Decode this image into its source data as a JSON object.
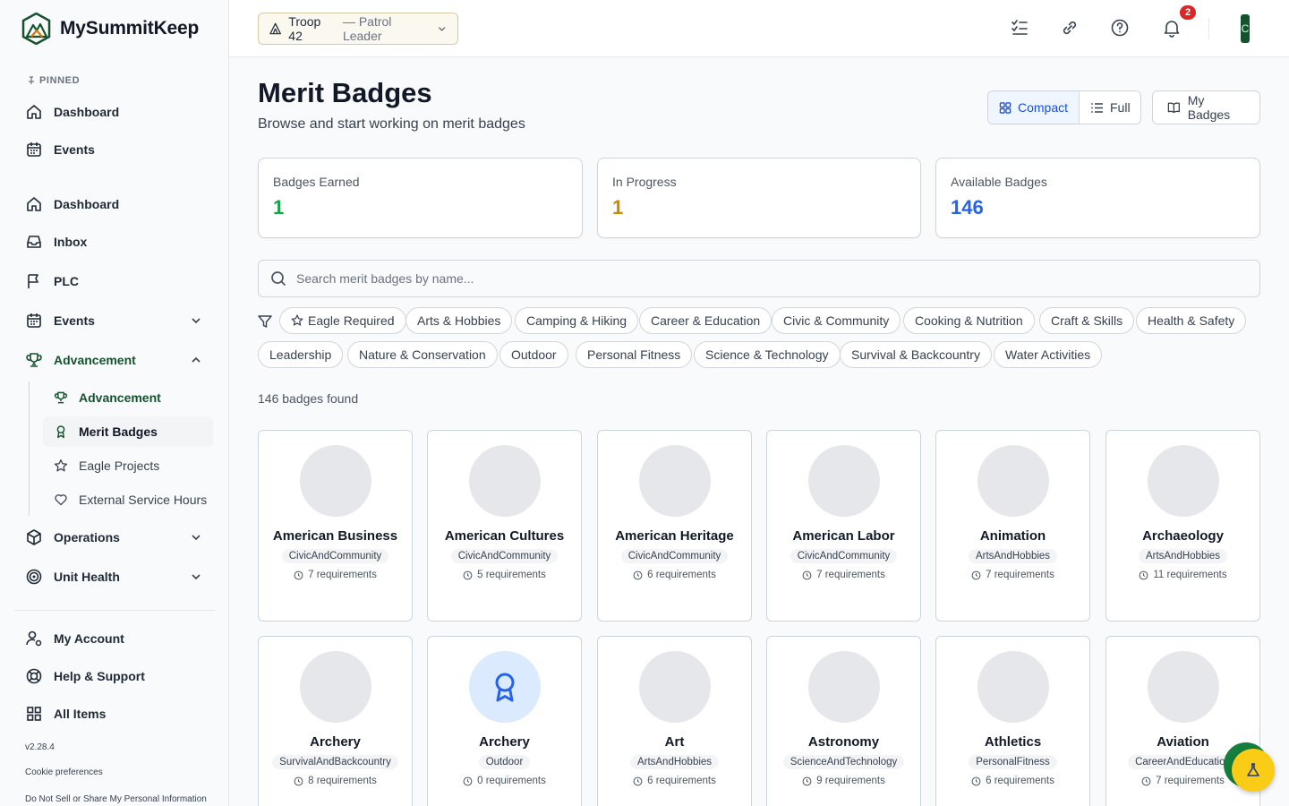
{
  "app": {
    "name": "MySummitKeep",
    "version": "v2.28.4"
  },
  "sidebar": {
    "pinned_label": "PINNED",
    "pinned": [
      {
        "label": "Dashboard",
        "icon": "home-icon"
      },
      {
        "label": "Events",
        "icon": "calendar-icon"
      }
    ],
    "items": [
      {
        "label": "Dashboard",
        "icon": "home-icon"
      },
      {
        "label": "Inbox",
        "icon": "inbox-icon"
      },
      {
        "label": "PLC",
        "icon": "flag-icon"
      },
      {
        "label": "Events",
        "icon": "calendar-icon",
        "expandable": true
      },
      {
        "label": "Advancement",
        "icon": "trophy-icon",
        "expanded": true
      },
      {
        "label": "Operations",
        "icon": "box-icon",
        "expandable": true
      },
      {
        "label": "Unit Health",
        "icon": "target-icon",
        "expandable": true
      }
    ],
    "advancement_sub": [
      {
        "label": "Advancement",
        "icon": "trophy-icon"
      },
      {
        "label": "Merit Badges",
        "icon": "badge-icon",
        "selected": true
      },
      {
        "label": "Eagle Projects",
        "icon": "star-icon"
      },
      {
        "label": "External Service Hours",
        "icon": "heart-icon"
      }
    ],
    "bottom": [
      {
        "label": "My Account",
        "icon": "user-gear-icon"
      },
      {
        "label": "Help & Support",
        "icon": "lifebuoy-icon"
      },
      {
        "label": "All Items",
        "icon": "grid-icon"
      }
    ],
    "cookie": "Cookie preferences",
    "dnsmpi": "Do Not Sell or Share My Personal Information"
  },
  "topbar": {
    "troop": "Troop 42",
    "role": "— Patrol Leader",
    "notifications": "2",
    "avatar_initial": "C"
  },
  "page": {
    "title": "Merit Badges",
    "subtitle": "Browse and start working on merit badges",
    "view_compact": "Compact",
    "view_full": "Full",
    "my_badges": "My Badges"
  },
  "stats": [
    {
      "label": "Badges Earned",
      "value": "1",
      "color": "#16a34a"
    },
    {
      "label": "In Progress",
      "value": "1",
      "color": "#ca8a04"
    },
    {
      "label": "Available Badges",
      "value": "146",
      "color": "#2563eb"
    }
  ],
  "search": {
    "placeholder": "Search merit badges by name...",
    "value": ""
  },
  "filters": [
    "Eagle Required",
    "Arts & Hobbies",
    "Camping & Hiking",
    "Career & Education",
    "Civic & Community",
    "Cooking & Nutrition",
    "Craft & Skills",
    "Health & Safety",
    "Leadership",
    "Nature & Conservation",
    "Outdoor",
    "Personal Fitness",
    "Science & Technology",
    "Survival & Backcountry",
    "Water Activities"
  ],
  "results_count": "146 badges found",
  "badges": [
    {
      "name": "American Business",
      "category": "CivicAndCommunity",
      "requirements": "7 requirements"
    },
    {
      "name": "American Cultures",
      "category": "CivicAndCommunity",
      "requirements": "5 requirements"
    },
    {
      "name": "American Heritage",
      "category": "CivicAndCommunity",
      "requirements": "6 requirements"
    },
    {
      "name": "American Labor",
      "category": "CivicAndCommunity",
      "requirements": "7 requirements"
    },
    {
      "name": "Animation",
      "category": "ArtsAndHobbies",
      "requirements": "7 requirements"
    },
    {
      "name": "Archaeology",
      "category": "ArtsAndHobbies",
      "requirements": "11 requirements"
    },
    {
      "name": "Archery",
      "category": "SurvivalAndBackcountry",
      "requirements": "8 requirements"
    },
    {
      "name": "Archery",
      "category": "Outdoor",
      "requirements": "0 requirements",
      "icon": "award-icon"
    },
    {
      "name": "Art",
      "category": "ArtsAndHobbies",
      "requirements": "6 requirements"
    },
    {
      "name": "Astronomy",
      "category": "ScienceAndTechnology",
      "requirements": "9 requirements"
    },
    {
      "name": "Athletics",
      "category": "PersonalFitness",
      "requirements": "6 requirements"
    },
    {
      "name": "Aviation",
      "category": "CareerAndEducation",
      "requirements": "7 requirements"
    }
  ]
}
